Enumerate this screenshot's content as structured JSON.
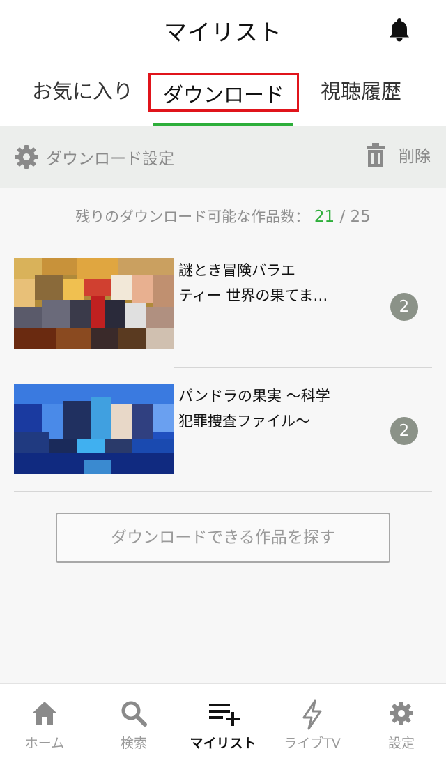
{
  "header": {
    "title": "マイリスト",
    "icon": "bell-icon"
  },
  "tabs": [
    {
      "label": "お気に入り",
      "active": false
    },
    {
      "label": "ダウンロード",
      "active": true
    },
    {
      "label": "視聴履歴",
      "active": false
    }
  ],
  "toolbar": {
    "settings_label": "ダウンロード設定",
    "delete_label": "削除"
  },
  "counter": {
    "label": "残りのダウンロード可能な作品数：",
    "remaining": "21",
    "separator": " / ",
    "total": "25"
  },
  "downloads": [
    {
      "title_line1": "謎とき冒険バラエ",
      "title_line2": "ティー 世界の果てま…",
      "count": "2"
    },
    {
      "title_line1": "パンドラの果実 〜科学",
      "title_line2": "犯罪捜査ファイル〜",
      "count": "2"
    }
  ],
  "find_button_label": "ダウンロードできる作品を探す",
  "bottom_nav": [
    {
      "label": "ホーム",
      "icon": "home-icon"
    },
    {
      "label": "検索",
      "icon": "search-icon"
    },
    {
      "label": "マイリスト",
      "icon": "mylist-add-icon",
      "active": true
    },
    {
      "label": "ライブTV",
      "icon": "lightning-icon"
    },
    {
      "label": "設定",
      "icon": "gear-icon"
    }
  ],
  "colors": {
    "accent_green": "#2dae3a",
    "highlight_red": "#e0141b",
    "badge_gray": "#8b9288"
  }
}
